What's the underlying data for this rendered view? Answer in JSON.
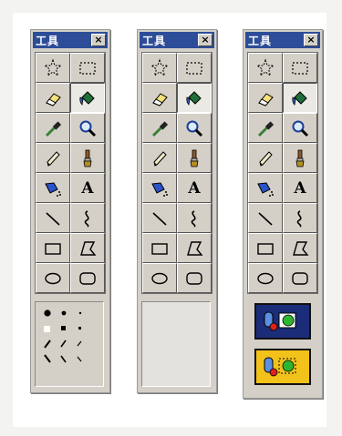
{
  "toolboxes": [
    {
      "title": "工具",
      "close_label": "×",
      "selected_tool": "fill"
    },
    {
      "title": "工具",
      "close_label": "×",
      "selected_tool": "fill"
    },
    {
      "title": "工具",
      "close_label": "×",
      "selected_tool": "fill"
    }
  ],
  "tools": [
    {
      "name": "free-form-select",
      "icon": "star-select-icon"
    },
    {
      "name": "rect-select",
      "icon": "dashed-rect-icon"
    },
    {
      "name": "eraser",
      "icon": "eraser-icon"
    },
    {
      "name": "fill",
      "icon": "paint-bucket-icon"
    },
    {
      "name": "color-picker",
      "icon": "eyedropper-icon"
    },
    {
      "name": "magnifier",
      "icon": "magnifier-icon"
    },
    {
      "name": "pencil",
      "icon": "pencil-icon"
    },
    {
      "name": "brush",
      "icon": "brush-icon"
    },
    {
      "name": "airbrush",
      "icon": "airbrush-icon"
    },
    {
      "name": "text",
      "icon": "text-icon",
      "label": "A"
    },
    {
      "name": "line",
      "icon": "line-icon"
    },
    {
      "name": "curve",
      "icon": "curve-icon"
    },
    {
      "name": "rectangle",
      "icon": "rectangle-icon"
    },
    {
      "name": "polygon",
      "icon": "polygon-icon"
    },
    {
      "name": "ellipse",
      "icon": "ellipse-icon"
    },
    {
      "name": "rounded-rect",
      "icon": "rounded-rect-icon"
    }
  ],
  "colors": {
    "title_bar": "#2d4d98",
    "face": "#d4d0c8",
    "option_yellow": "#f2c21a",
    "option_navy": "#1b2c78"
  },
  "panel_options": {
    "brush_shapes": "brush-shape-options",
    "transparency": [
      "opaque-selection-icon",
      "transparent-selection-icon"
    ]
  }
}
